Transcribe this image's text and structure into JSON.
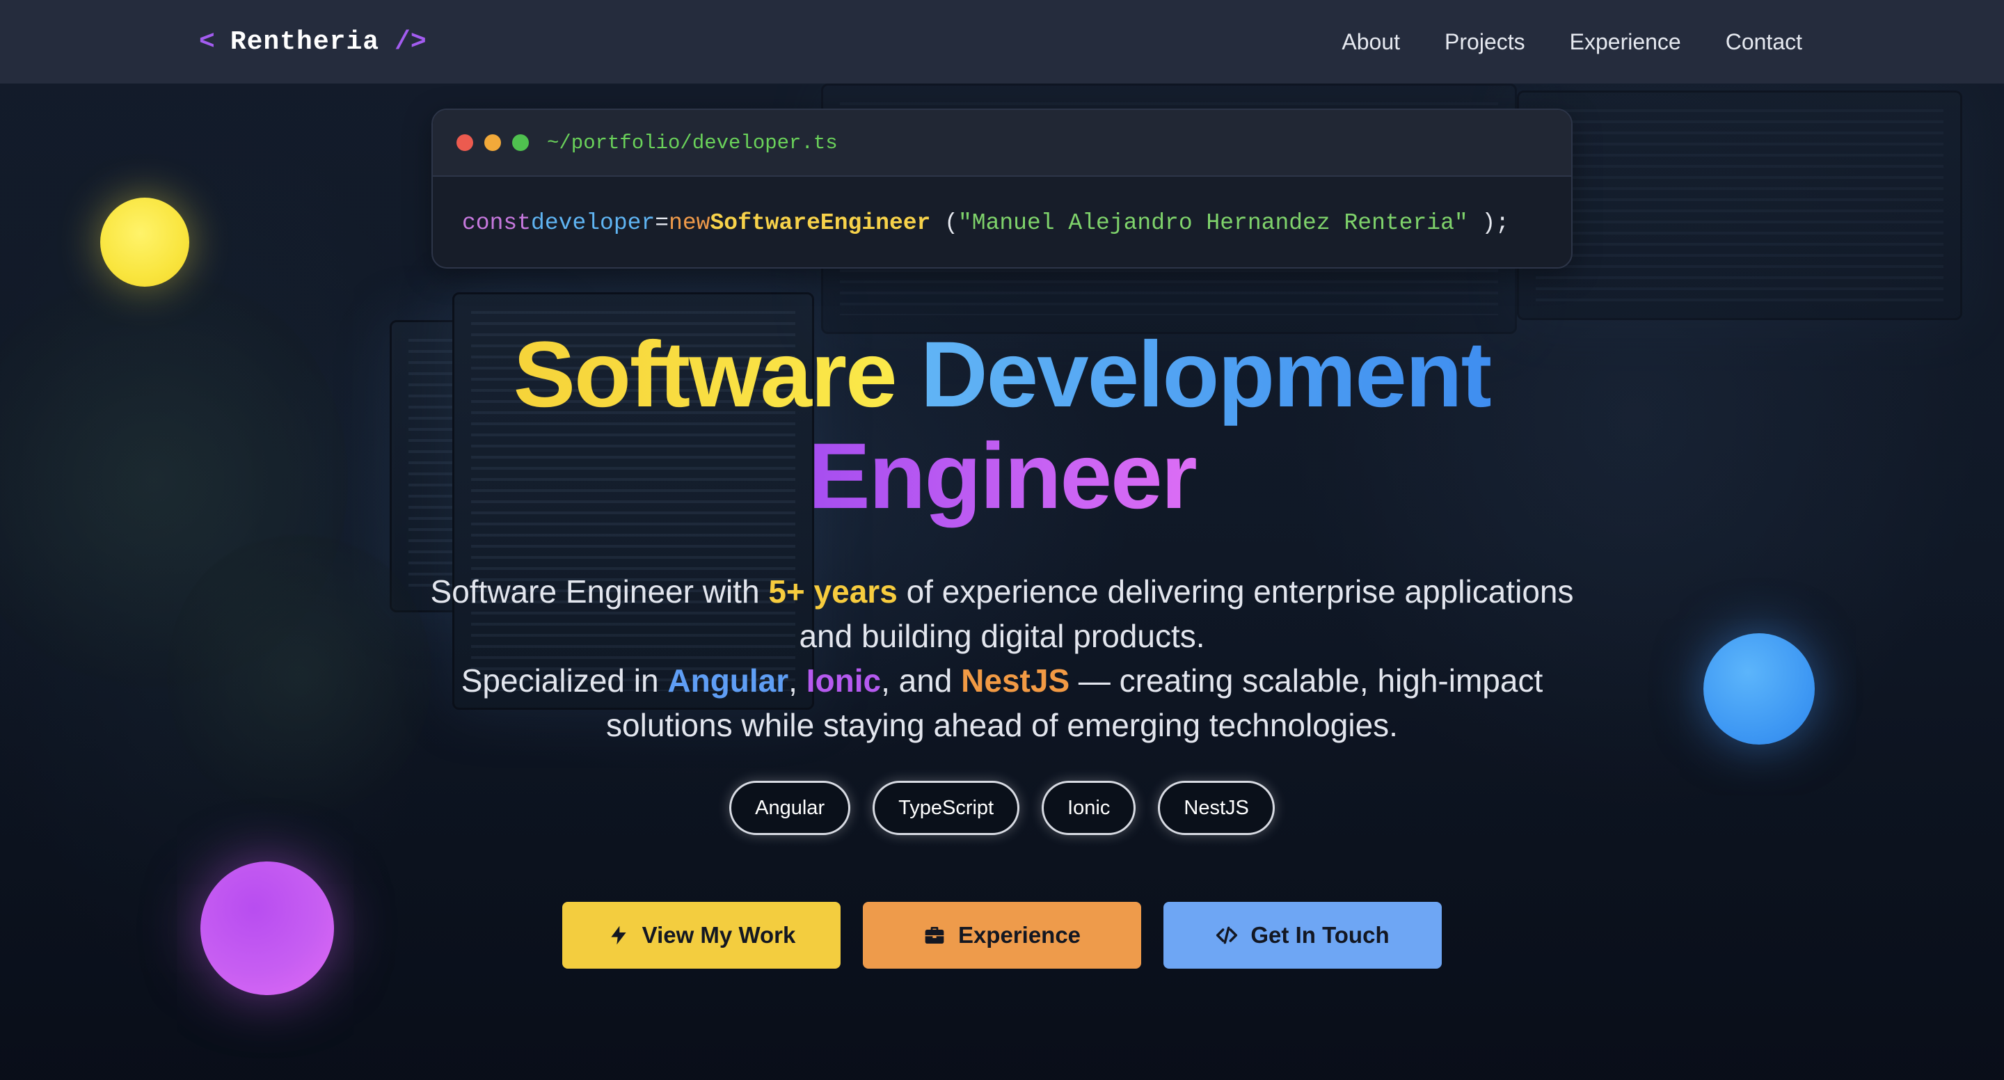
{
  "nav": {
    "logo_open": "<",
    "logo_name": "Rentheria",
    "logo_close": "/>",
    "links": [
      "About",
      "Projects",
      "Experience",
      "Contact"
    ]
  },
  "code_card": {
    "path": "~/portfolio/developer.ts",
    "tokens": {
      "keyword_const": "const",
      "variable": "developer",
      "operator": "=",
      "keyword_new": "new",
      "class_name": "SoftwareEngineer",
      "open_paren": " (",
      "string": "\"Manuel Alejandro Hernandez Renteria\"",
      "close": " );"
    },
    "dots": [
      "#ec5b4f",
      "#f2a93a",
      "#4fc14f"
    ]
  },
  "headline": {
    "word1": "Software",
    "word2": "Development",
    "word3": "Engineer"
  },
  "description": {
    "line1_pre": "Software Engineer with ",
    "line1_hl": "5+ years",
    "line1_post": " of experience delivering enterprise applications",
    "line2": "and building digital products.",
    "line3_pre": "Specialized in ",
    "angular": "Angular",
    "comma1": ", ",
    "ionic": "Ionic",
    "and": ", and ",
    "nestjs": "NestJS",
    "line3_post": " — creating scalable, high-impact",
    "line4": "solutions while staying ahead of emerging technologies."
  },
  "tech_pills": [
    "Angular",
    "TypeScript",
    "Ionic",
    "NestJS"
  ],
  "buttons": {
    "work": "View My Work",
    "experience": "Experience",
    "contact": "Get In Touch"
  },
  "icons": {
    "work": "bolt-icon",
    "experience": "briefcase-icon",
    "contact": "code-icon"
  },
  "colors": {
    "yellow": "#f3cd3f",
    "orange": "#ee9b4b",
    "blue": "#6ea6f4",
    "purple": "#b65af0",
    "nav_bg": "#252c3d"
  }
}
